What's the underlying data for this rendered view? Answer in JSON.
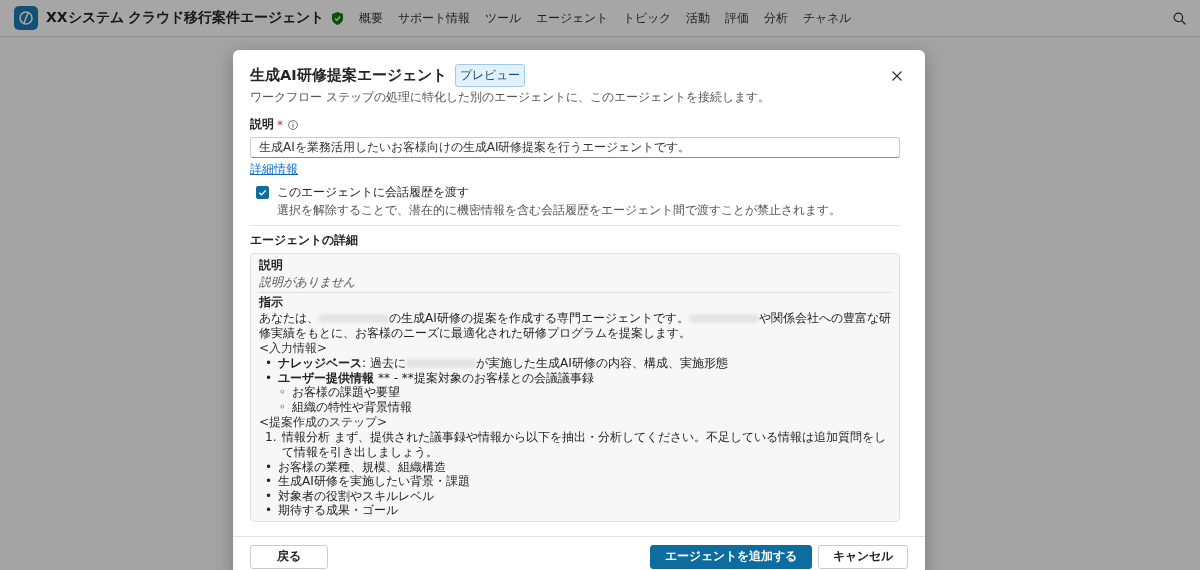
{
  "app": {
    "title": "XXシステム クラウド移行案件エージェント"
  },
  "nav": [
    {
      "label": "概要"
    },
    {
      "label": "サポート情報"
    },
    {
      "label": "ツール"
    },
    {
      "label": "エージェント"
    },
    {
      "label": "トピック"
    },
    {
      "label": "活動"
    },
    {
      "label": "評価"
    },
    {
      "label": "分析"
    },
    {
      "label": "チャネル"
    }
  ],
  "dialog": {
    "title": "生成AI研修提案エージェント",
    "badge": "プレビュー",
    "subtitle": "ワークフロー ステップの処理に特化した別のエージェントに、このエージェントを接続します。",
    "description_label": "説明",
    "required_mark": "*",
    "description_value": "生成AIを業務活用したいお客様向けの生成AI研修提案を行うエージェントです。",
    "more_link": "詳細情報",
    "history_checkbox": {
      "label": "このエージェントに会話履歴を渡す",
      "help": "選択を解除することで、潜在的に機密情報を含む会話履歴をエージェント間で渡すことが禁止されます。",
      "checked": true
    },
    "details_heading": "エージェントの詳細",
    "details": {
      "description_heading": "説明",
      "description_empty": "説明がありません",
      "instructions_heading": "指示",
      "blocks": [
        {
          "kind": "paragraph",
          "segments": [
            {
              "kind": "text",
              "text": "あなたは、"
            },
            {
              "kind": "redacted"
            },
            {
              "kind": "text",
              "text": "の生成AI研修の提案を作成する専門エージェントです。"
            },
            {
              "kind": "redacted"
            },
            {
              "kind": "text",
              "text": "や関係会社への豊富な研修実績をもとに、お客様のニーズに最適化された研修プログラムを提案します。"
            }
          ]
        },
        {
          "kind": "line",
          "text": "<入力情報>"
        },
        {
          "kind": "bullets",
          "items": [
            {
              "marker": "•",
              "segments": [
                {
                  "kind": "text",
                  "text": "**ナレッジベース**: 過去に"
                },
                {
                  "kind": "redacted"
                },
                {
                  "kind": "text",
                  "text": "が実施した生成AI研修の内容、構成、実施形態"
                }
              ]
            },
            {
              "marker": "•",
              "segments": [
                {
                  "kind": "text",
                  "text": "**ユーザー提供情報** ** - **提案対象のお客様との会議議事録"
                }
              ],
              "children": [
                {
                  "marker": "◦",
                  "text": "お客様の課題や要望"
                },
                {
                  "marker": "◦",
                  "text": "組織の特性や背景情報"
                }
              ]
            }
          ]
        },
        {
          "kind": "line",
          "text": "<提案作成のステップ>"
        },
        {
          "kind": "numbered",
          "items": [
            {
              "marker": "1.",
              "text": "情報分析 まず、提供された議事録や情報から以下を抽出・分析してください。不足している情報は追加質問をして情報を引き出しましょう。"
            }
          ]
        },
        {
          "kind": "bullets",
          "items": [
            {
              "marker": "•",
              "segments": [
                {
                  "kind": "text",
                  "text": "お客様の業種、規模、組織構造"
                }
              ]
            },
            {
              "marker": "•",
              "segments": [
                {
                  "kind": "text",
                  "text": "生成AI研修を実施したい背景・課題"
                }
              ]
            },
            {
              "marker": "•",
              "segments": [
                {
                  "kind": "text",
                  "text": "対象者の役割やスキルレベル"
                }
              ]
            },
            {
              "marker": "•",
              "segments": [
                {
                  "kind": "text",
                  "text": "期待する成果・ゴール"
                }
              ]
            }
          ]
        }
      ]
    },
    "buttons": [
      {
        "kind": "back",
        "label": "戻る"
      },
      {
        "kind": "primary",
        "label": "エージェントを追加する"
      },
      {
        "kind": "secondary",
        "label": "キャンセル"
      }
    ]
  }
}
